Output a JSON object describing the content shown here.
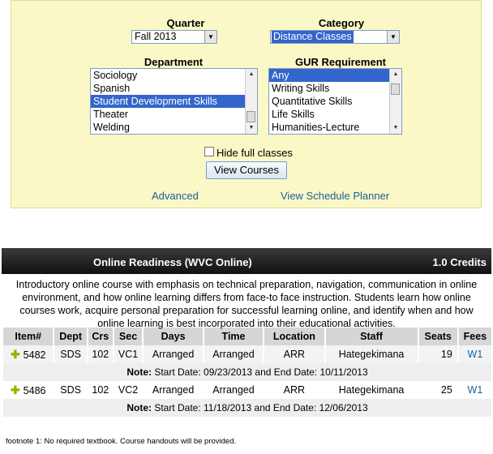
{
  "search": {
    "quarter_label": "Quarter",
    "quarter_value": "Fall 2013",
    "category_label": "Category",
    "category_value": "Distance Classes",
    "department_label": "Department",
    "departments": [
      "Sociology",
      "Spanish",
      "Student Development Skills",
      "Theater",
      "Welding"
    ],
    "department_selected": "Student Development Skills",
    "gur_label": "GUR Requirement",
    "gurs": [
      "Any",
      "Writing Skills",
      "Quantitative Skills",
      "Life Skills",
      "Humanities-Lecture"
    ],
    "gur_selected": "Any",
    "hide_full_label": "Hide full classes",
    "view_courses_label": "View Courses",
    "advanced_link": "Advanced",
    "planner_link": "View Schedule Planner"
  },
  "course": {
    "title": "Online Readiness (WVC Online)",
    "credits": "1.0 Credits",
    "description": "Introductory online course with emphasis on technical preparation, navigation, communication in online environment, and how online learning differs from face-to face instruction. Students learn how online courses work, acquire personal preparation for successful learning online, and identify when and how online learning is best incorporated into their educational activities.",
    "columns": [
      "Item#",
      "Dept",
      "Crs",
      "Sec",
      "Days",
      "Time",
      "Location",
      "Staff",
      "Seats",
      "Fees"
    ],
    "sections": [
      {
        "item": "5482",
        "dept": "SDS",
        "crs": "102",
        "sec": "VC1",
        "days": "Arranged",
        "time": "Arranged",
        "location": "ARR",
        "staff": "Hategekimana",
        "seats": "19",
        "fees": "W1",
        "note_label": "Note:",
        "note": "Start Date: 09/23/2013 and End Date: 10/11/2013"
      },
      {
        "item": "5486",
        "dept": "SDS",
        "crs": "102",
        "sec": "VC2",
        "days": "Arranged",
        "time": "Arranged",
        "location": "ARR",
        "staff": "Hategekimana",
        "seats": "25",
        "fees": "W1",
        "note_label": "Note:",
        "note": "Start Date: 11/18/2013 and End Date: 12/06/2013"
      }
    ],
    "footnote": "footnote 1: No required textbook. Course handouts will be provided."
  },
  "colors": {
    "accent": "#3366cc",
    "panel": "#fbf8c7",
    "link": "#1a5f99",
    "header": "#1a1a1a"
  }
}
